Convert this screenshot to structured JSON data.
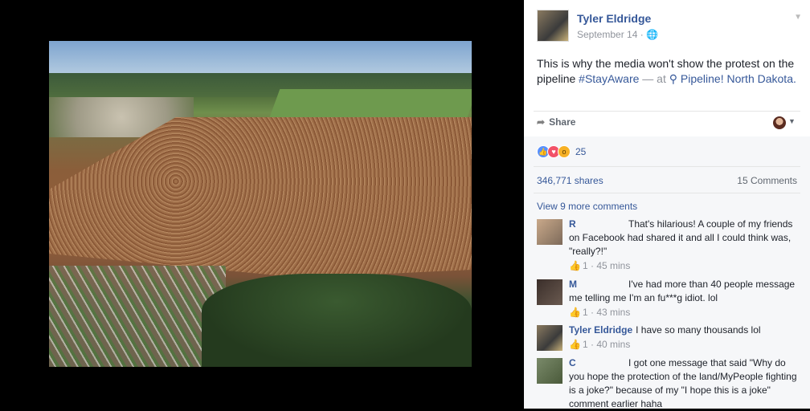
{
  "post": {
    "author": "Tyler Eldridge",
    "date": "September 14",
    "text_prefix": "This is why the media won't show the protest on the pipeline ",
    "hashtag": "#StayAware",
    "at": " — at ",
    "place_icon": "location-pin-icon",
    "place": "Pipeline! North Dakota."
  },
  "actions": {
    "share_label": "Share"
  },
  "feedback": {
    "reactions_count": "25",
    "reaction_types": [
      "like",
      "love",
      "wow"
    ],
    "shares": "346,771 shares",
    "comments": "15 Comments",
    "view_more": "View 9 more comments"
  },
  "comments": [
    {
      "name": "R",
      "text": "That's hilarious! A couple of my friends on Facebook had shared it and all I could think was, \"really?!\"",
      "likes": "1",
      "time": "45 mins"
    },
    {
      "name": "M",
      "text": "I've had more than 40 people message me telling me I'm an fu***g idiot. lol",
      "likes": "1",
      "time": "43 mins"
    },
    {
      "name": "Tyler Eldridge",
      "text": "I have so many thousands lol",
      "likes": "1",
      "time": "40 mins"
    },
    {
      "name": "C",
      "text": "I got one message that said \"Why do you hope the protection of the land/MyPeople fighting is a joke?\" because of my \"I hope this is a joke\" comment earlier haha",
      "likes": "",
      "time": ""
    }
  ],
  "colors": {
    "link": "#365899",
    "like": "#5890ff",
    "love": "#f25268",
    "wow": "#f7b125"
  }
}
